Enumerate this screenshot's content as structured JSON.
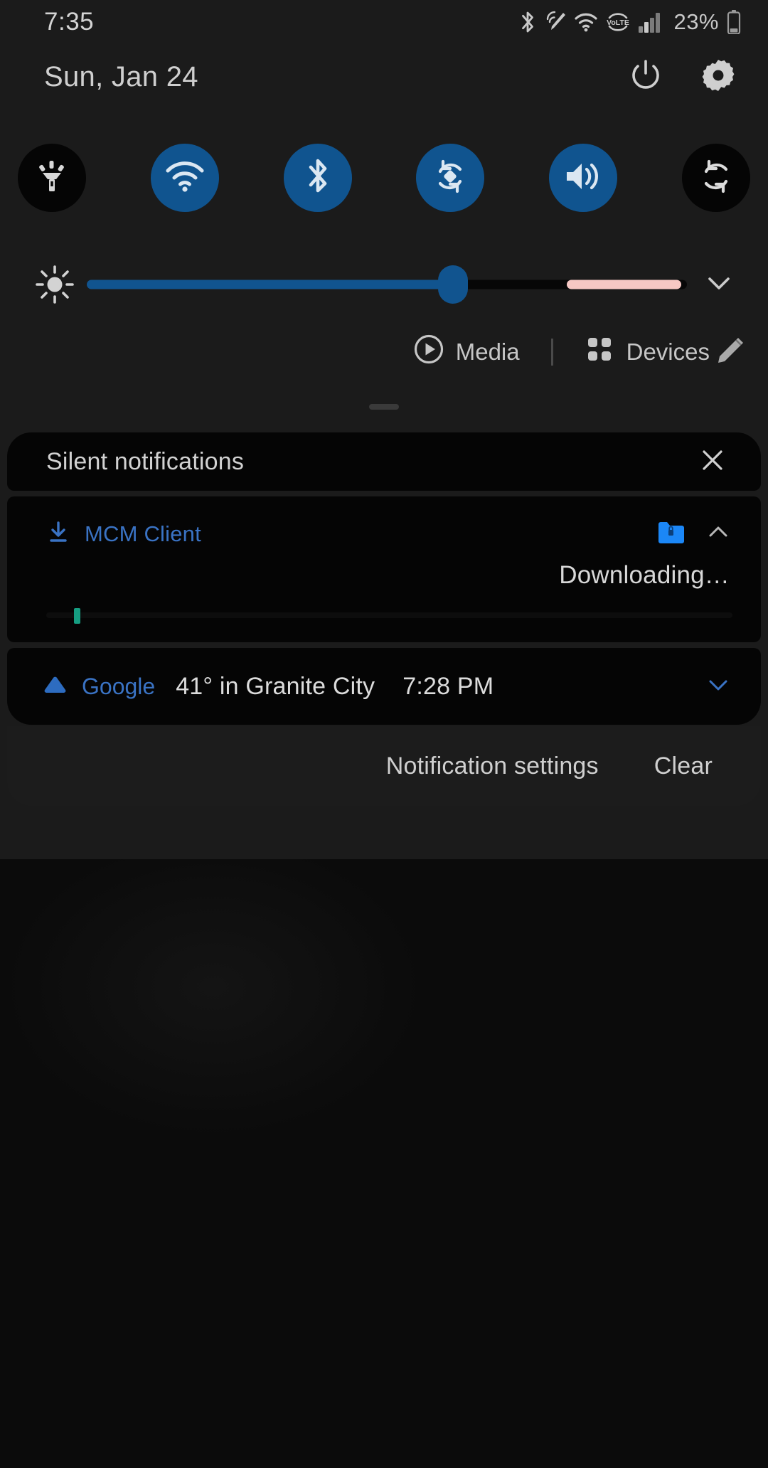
{
  "statusbar": {
    "clock": "7:35",
    "battery_percent": "23%",
    "icons": [
      "bluetooth-icon",
      "spen-icon",
      "wifi-icon",
      "volte-icon",
      "cellular-signal-icon",
      "battery-icon"
    ],
    "signal_bars_filled": 2,
    "signal_bars_total": 4
  },
  "header": {
    "date": "Sun, Jan 24",
    "power_label": "Power",
    "settings_label": "Settings"
  },
  "tiles": [
    {
      "name": "flashlight",
      "label": "Flashlight",
      "icon": "flashlight-icon",
      "state": "off"
    },
    {
      "name": "wifi",
      "label": "Wi-Fi",
      "icon": "wifi-icon",
      "state": "on"
    },
    {
      "name": "bluetooth",
      "label": "Bluetooth",
      "icon": "bluetooth-icon",
      "state": "on"
    },
    {
      "name": "auto-rotate",
      "label": "Auto rotate",
      "icon": "auto-rotate-icon",
      "state": "on"
    },
    {
      "name": "sound",
      "label": "Sound",
      "icon": "volume-icon",
      "state": "on"
    },
    {
      "name": "sync",
      "label": "Sync",
      "icon": "sync-icon",
      "state": "off"
    }
  ],
  "brightness": {
    "icon": "brightness-sun-icon",
    "value_percent": 61,
    "pink_start_percent": 80,
    "pink_end_percent": 99,
    "expand_label": "Expand"
  },
  "media_row": {
    "media_label": "Media",
    "devices_label": "Devices",
    "media_icon": "play-circle-icon",
    "devices_icon": "devices-grid-icon",
    "edit_icon": "pencil-edit-icon"
  },
  "notifications": {
    "silent_header": {
      "title": "Silent notifications",
      "close_icon": "close-x-icon"
    },
    "items": [
      {
        "app": "MCM Client",
        "app_icon": "download-arrow-icon",
        "badge_icon": "secure-folder-icon",
        "collapse_icon": "chevron-up-icon",
        "body": "Downloading…",
        "progress_percent": 4
      },
      {
        "app": "Google",
        "app_icon": "google-cloud-icon",
        "title": "41° in Granite City",
        "time": "7:28 PM",
        "expand_icon": "chevron-down-icon"
      }
    ],
    "footer": {
      "settings_label": "Notification settings",
      "clear_label": "Clear"
    }
  },
  "colors": {
    "accent_blue": "#10548f",
    "link_blue": "#3a73c4",
    "shade_bg": "#1b1b1b",
    "card_bg": "#050505",
    "progress_teal": "#169e82",
    "pink_segment": "#f6c8c4"
  }
}
